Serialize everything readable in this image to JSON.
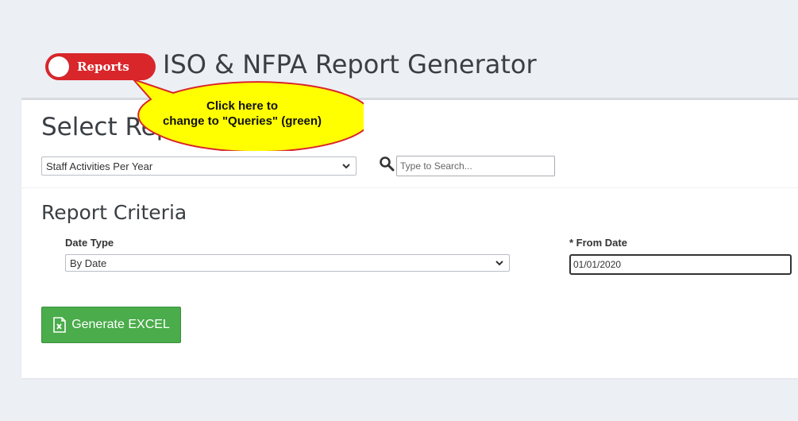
{
  "header": {
    "toggle_label": "Reports",
    "title": "ISO & NFPA Report Generator"
  },
  "callout": {
    "line1": "Click here to",
    "line2": "change to \"Queries\" (green)"
  },
  "select_report": {
    "title": "Select Report",
    "selected": "Staff Activities Per Year"
  },
  "search": {
    "placeholder": "Type to Search..."
  },
  "criteria": {
    "title": "Report Criteria",
    "date_type_label": "Date Type",
    "date_type_value": "By Date",
    "from_date_label": "* From Date",
    "from_date_value": "01/01/2020"
  },
  "actions": {
    "generate_label": "Generate EXCEL"
  },
  "colors": {
    "toggle": "#d9262b",
    "callout_fill": "#ffff00",
    "callout_border": "#d9262b",
    "generate_button": "#4aac4a"
  },
  "icons": [
    "search-icon",
    "chevron-down-icon",
    "excel-file-icon"
  ]
}
